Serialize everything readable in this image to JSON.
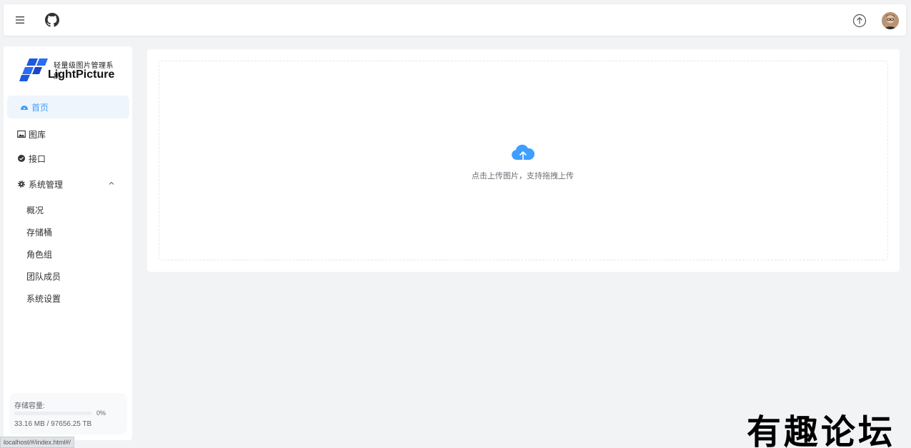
{
  "topbar": {
    "menu_icon": "hamburger-icon",
    "github_icon": "github-icon",
    "upload_icon": "upload-circle-icon",
    "avatar": "user-avatar"
  },
  "brand": {
    "subtitle": "轻量级图片管理系统",
    "name": "LightPicture"
  },
  "nav": {
    "home": "首页",
    "gallery": "图库",
    "api": "接口",
    "system": "系统管理",
    "sub": [
      "概况",
      "存储桶",
      "角色组",
      "团队成员",
      "系统设置"
    ]
  },
  "storage": {
    "label": "存储容量:",
    "percent": "0%",
    "used_fraction": 0.0,
    "size": "33.16 MB / 97656.25 TB"
  },
  "upload": {
    "text": "点击上传图片，支持拖拽上传"
  },
  "status_url": "localhost/#/index.html#/",
  "watermark": "有趣论坛",
  "colors": {
    "accent": "#409eff",
    "background": "#f2f3f5",
    "active_bg": "#eef5fd"
  }
}
